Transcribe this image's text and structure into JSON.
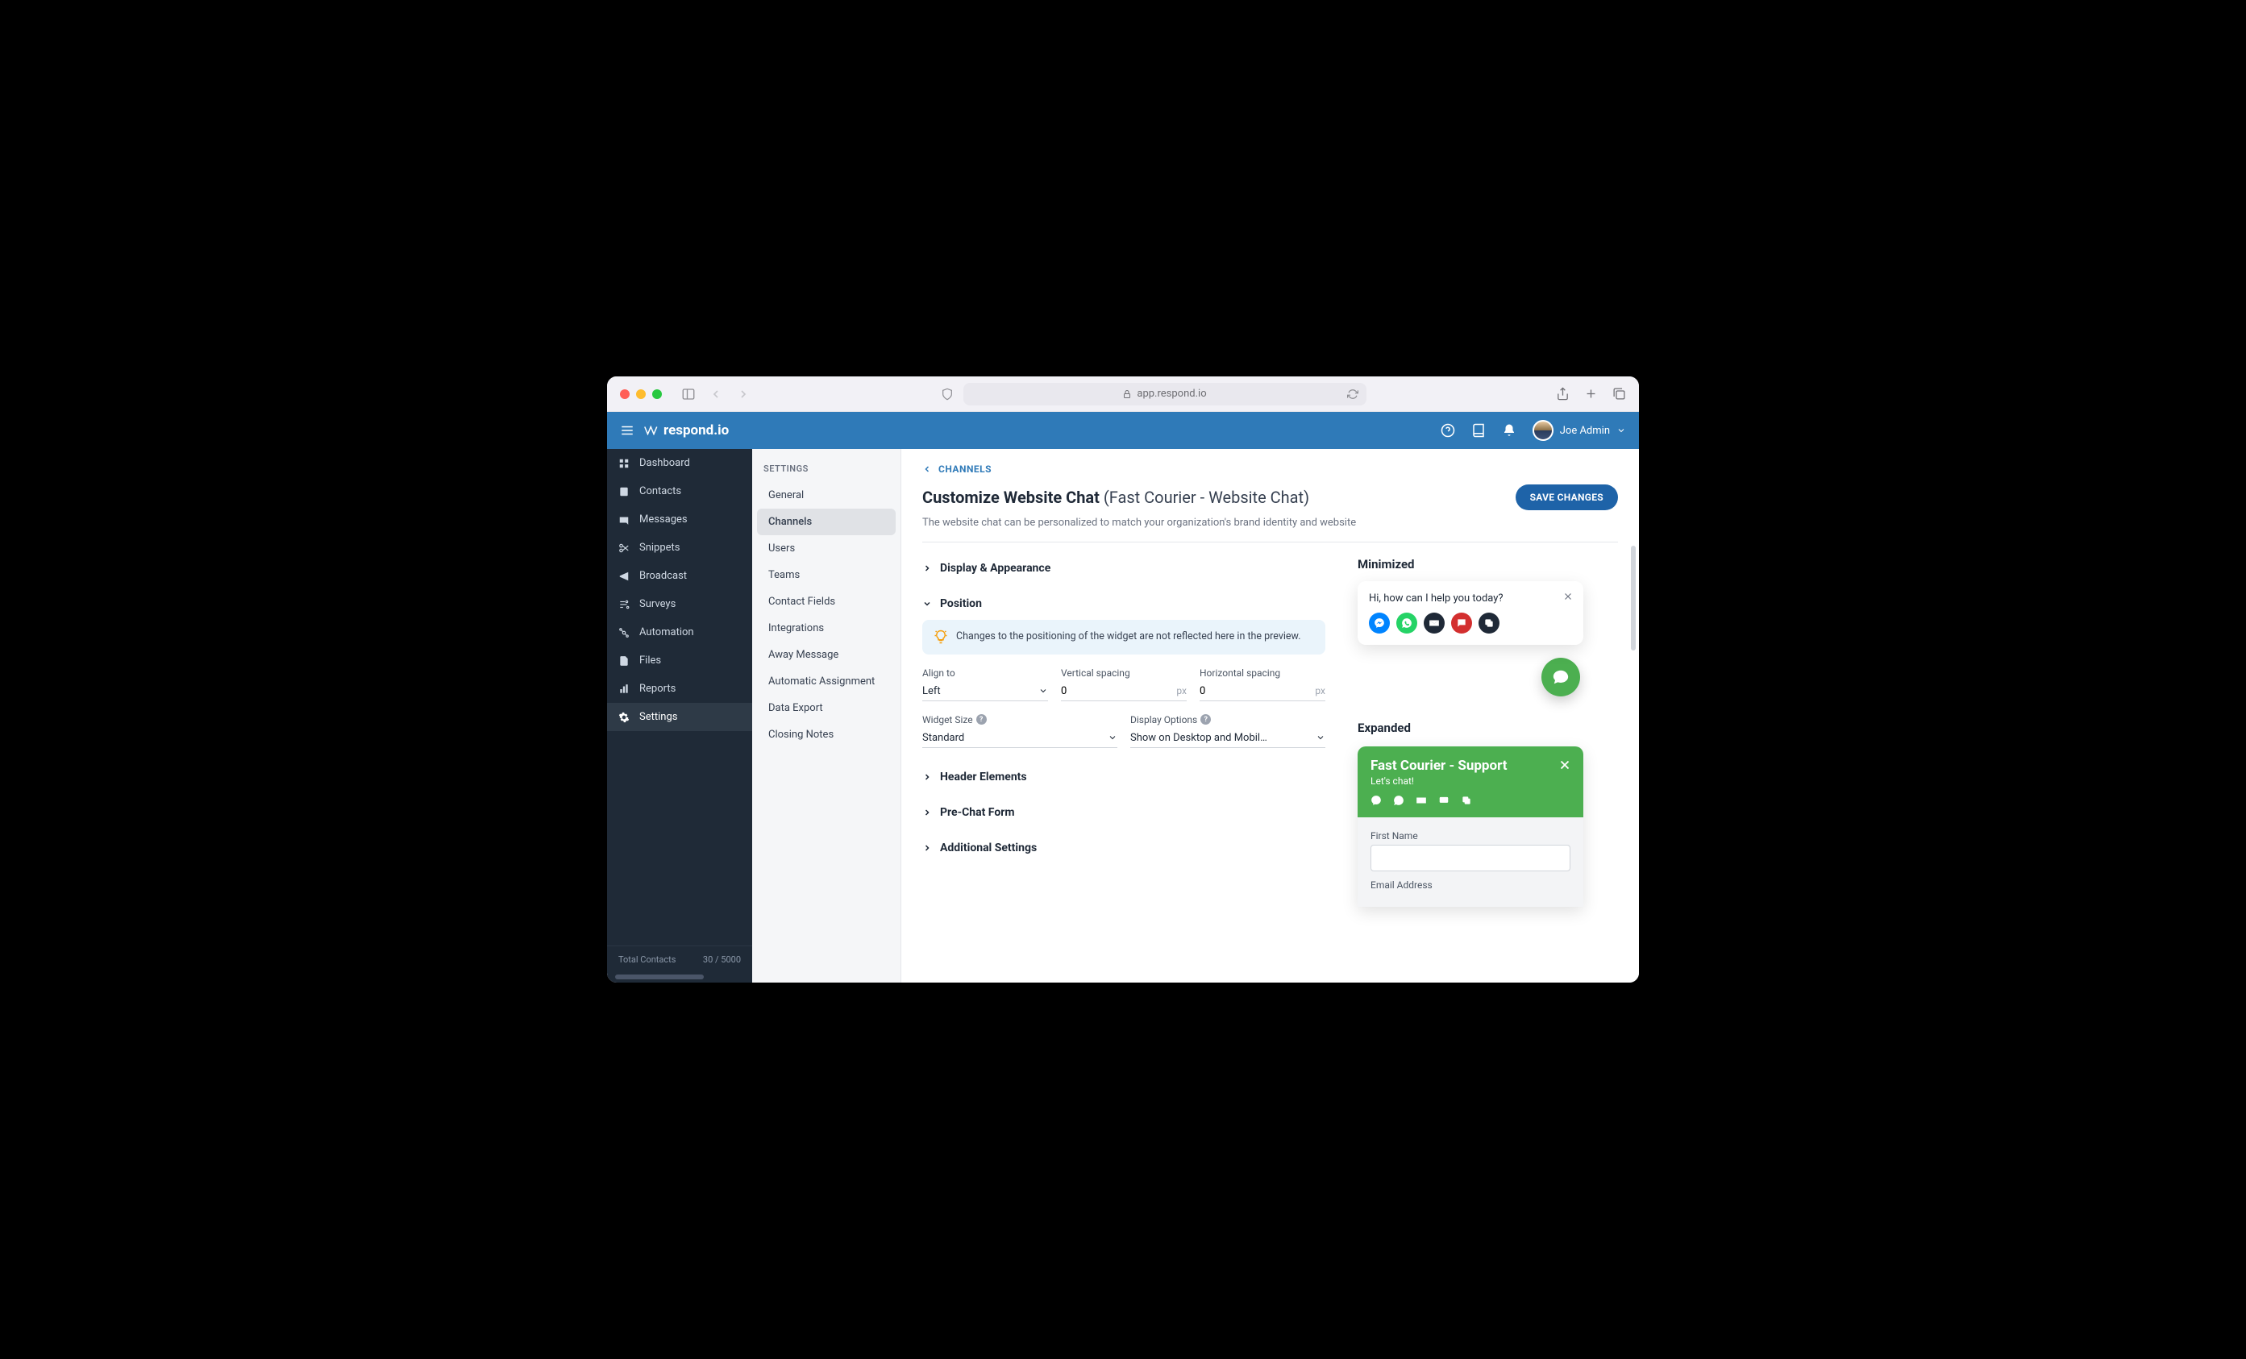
{
  "browser": {
    "url": "app.respond.io"
  },
  "header": {
    "logo": "respond.io",
    "user": "Joe Admin"
  },
  "nav": {
    "items": [
      {
        "label": "Dashboard",
        "icon": "dashboard"
      },
      {
        "label": "Contacts",
        "icon": "contacts"
      },
      {
        "label": "Messages",
        "icon": "messages"
      },
      {
        "label": "Snippets",
        "icon": "snippets"
      },
      {
        "label": "Broadcast",
        "icon": "broadcast"
      },
      {
        "label": "Surveys",
        "icon": "surveys"
      },
      {
        "label": "Automation",
        "icon": "automation"
      },
      {
        "label": "Files",
        "icon": "files"
      },
      {
        "label": "Reports",
        "icon": "reports"
      },
      {
        "label": "Settings",
        "icon": "settings",
        "active": true
      }
    ],
    "footer_label": "Total Contacts",
    "footer_value": "30 / 5000"
  },
  "settings_nav": {
    "title": "SETTINGS",
    "items": [
      "General",
      "Channels",
      "Users",
      "Teams",
      "Contact Fields",
      "Integrations",
      "Away Message",
      "Automatic Assignment",
      "Data Export",
      "Closing Notes"
    ],
    "active": "Channels"
  },
  "page": {
    "breadcrumb": "CHANNELS",
    "title": "Customize Website Chat",
    "title_sub": "(Fast Courier - Website Chat)",
    "desc": "The website chat can be personalized to match your organization's brand identity and website",
    "save_label": "SAVE CHANGES"
  },
  "sections": {
    "display": "Display & Appearance",
    "position": "Position",
    "header_elements": "Header Elements",
    "prechat": "Pre-Chat Form",
    "additional": "Additional Settings"
  },
  "tip": "Changes to the positioning of the widget are not reflected here in the preview.",
  "fields": {
    "align": {
      "label": "Align to",
      "value": "Left"
    },
    "vertical": {
      "label": "Vertical spacing",
      "value": "0",
      "unit": "px"
    },
    "horizontal": {
      "label": "Horizontal spacing",
      "value": "0",
      "unit": "px"
    },
    "widget_size": {
      "label": "Widget Size",
      "value": "Standard"
    },
    "display_opts": {
      "label": "Display Options",
      "value": "Show on Desktop and Mobil…"
    }
  },
  "preview": {
    "minimized_label": "Minimized",
    "minimized_text": "Hi, how can I help you today?",
    "expanded_label": "Expanded",
    "expanded_title": "Fast Courier - Support",
    "expanded_sub": "Let's chat!",
    "form": {
      "first_name": "First Name",
      "email": "Email Address"
    }
  }
}
